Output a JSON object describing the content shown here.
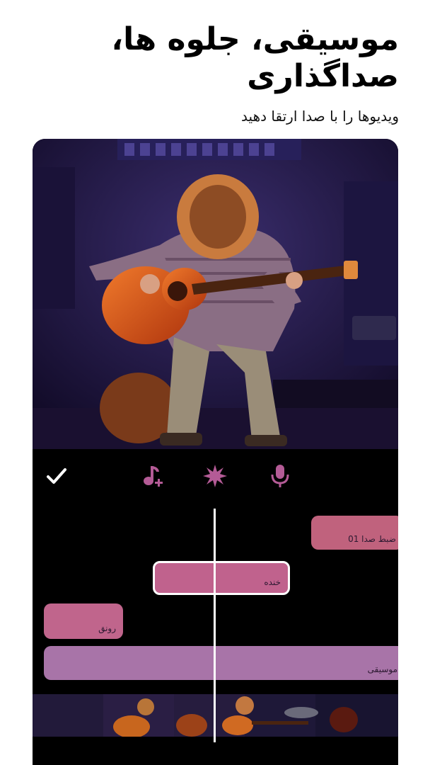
{
  "header": {
    "title": "موسیقی، جلوه ها، صداگذاری",
    "subtitle": "ویدیوها را با صدا ارتقا دهید"
  },
  "toolbar": {
    "confirm_icon": "check-icon",
    "add_music_icon": "music-note-plus-icon",
    "effects_icon": "starburst-icon",
    "record_icon": "microphone-icon",
    "accent_color": "#b45b96"
  },
  "timeline": {
    "clips": [
      {
        "label": "ضبط صدا 01",
        "color": "#c0627d"
      },
      {
        "label": "خنده",
        "color": "#c0628d"
      },
      {
        "label": "رونق",
        "color": "#c0658c"
      },
      {
        "label": "موسیقی",
        "color": "#a874a8"
      }
    ]
  }
}
